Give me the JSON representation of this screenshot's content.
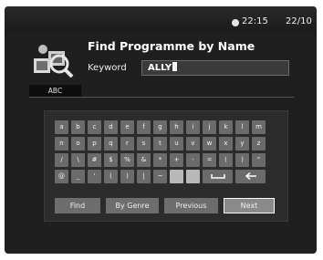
{
  "status": {
    "time": "22:15",
    "date": "22/10"
  },
  "header": {
    "title": "Find Programme by Name",
    "keyword_label": "Keyword",
    "keyword_value": "ALLY"
  },
  "tab": {
    "label": "ABC"
  },
  "keyboard": {
    "rows": [
      [
        "a",
        "b",
        "c",
        "d",
        "e",
        "f",
        "g",
        "h",
        "i",
        "j",
        "k",
        "l",
        "m"
      ],
      [
        "n",
        "o",
        "p",
        "q",
        "r",
        "s",
        "t",
        "u",
        "v",
        "w",
        "x",
        "y",
        "z"
      ],
      [
        "/",
        "\\",
        "#",
        "$",
        "%",
        "&",
        "*",
        "+",
        "-",
        "=",
        "(",
        ")",
        "\""
      ],
      [
        "@",
        "_",
        "'",
        "(",
        ")",
        "|",
        "~",
        "",
        "",
        "",
        "",
        ""
      ]
    ],
    "space_icon": "space-bar-icon",
    "backspace_icon": "backspace-arrow-icon"
  },
  "buttons": [
    {
      "label": "Find",
      "active": false
    },
    {
      "label": "By Genre",
      "active": false
    },
    {
      "label": "Previous",
      "active": false
    },
    {
      "label": "Next",
      "active": true
    }
  ]
}
